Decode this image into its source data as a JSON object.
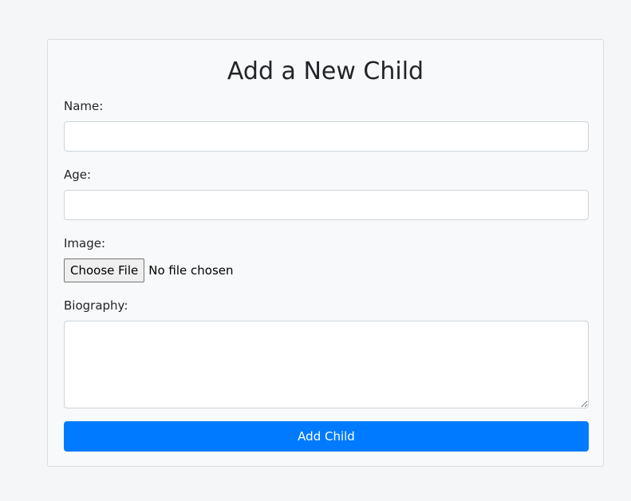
{
  "form": {
    "title": "Add a New Child",
    "name_label": "Name:",
    "name_value": "",
    "age_label": "Age:",
    "age_value": "",
    "image_label": "Image:",
    "file_button_label": "Choose File",
    "file_status": "No file chosen",
    "biography_label": "Biography:",
    "biography_value": "",
    "submit_label": "Add Child"
  },
  "colors": {
    "primary": "#007bff",
    "background": "#f5f6f8",
    "card": "#f8f9fa"
  }
}
